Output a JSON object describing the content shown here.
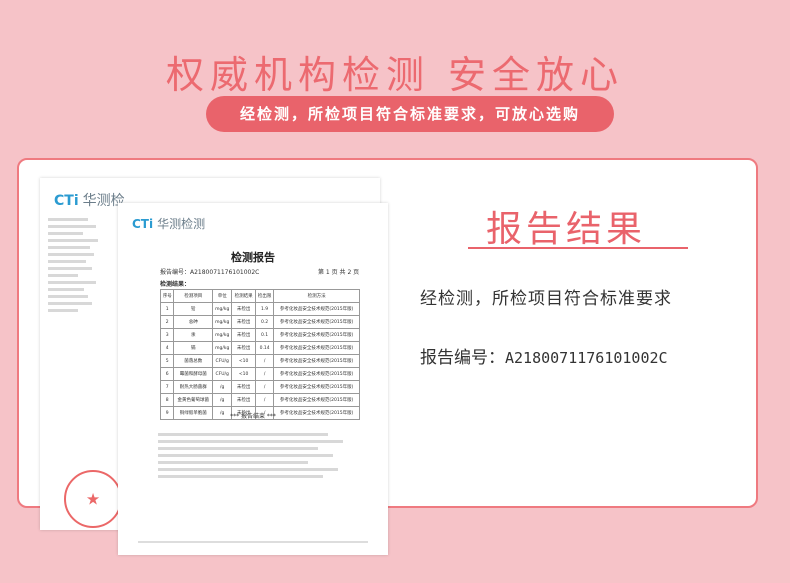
{
  "header": {
    "headline": "权威机构检测  安全放心",
    "subline": "经检测，所检项目符合标准要求，可放心选购"
  },
  "result": {
    "title": "报告结果",
    "description": "经检测，所检项目符合标准要求",
    "report_no_label": "报告编号：",
    "report_no_value": "A2180071176101002C"
  },
  "document": {
    "logo_mark": "CTi",
    "logo_text_back": "华测检",
    "logo_text_front": "华测检测",
    "title": "检测报告",
    "report_ref": "报告编号：A2180071176101002C",
    "page": "第 1 页 共 2 页",
    "section": "检测结果：",
    "end": "*** 报告结束 ***",
    "columns": [
      "序号",
      "检测项目",
      "单位",
      "检测结果",
      "检出限",
      "检测方法"
    ],
    "rows": [
      [
        "1",
        "铅",
        "mg/kg",
        "未检出",
        "1.9",
        "参考化妆品安全技术规范(2015年版)"
      ],
      [
        "2",
        "总砷",
        "mg/kg",
        "未检出",
        "0.2",
        "参考化妆品安全技术规范(2015年版)"
      ],
      [
        "3",
        "汞",
        "mg/kg",
        "未检出",
        "0.1",
        "参考化妆品安全技术规范(2015年版)"
      ],
      [
        "4",
        "镉",
        "mg/kg",
        "未检出",
        "0.14",
        "参考化妆品安全技术规范(2015年版)"
      ],
      [
        "5",
        "菌落总数",
        "CFU/g",
        "<10",
        "/",
        "参考化妆品安全技术规范(2015年版)"
      ],
      [
        "6",
        "霉菌和酵母菌",
        "CFU/g",
        "<10",
        "/",
        "参考化妆品安全技术规范(2015年版)"
      ],
      [
        "7",
        "耐热大肠菌群",
        "/g",
        "未检出",
        "/",
        "参考化妆品安全技术规范(2015年版)"
      ],
      [
        "8",
        "金黄色葡萄球菌",
        "/g",
        "未检出",
        "/",
        "参考化妆品安全技术规范(2015年版)"
      ],
      [
        "9",
        "铜绿假单胞菌",
        "/g",
        "未检出",
        "/",
        "参考化妆品安全技术规范(2015年版)"
      ]
    ]
  },
  "colors": {
    "accent": "#e9636b",
    "background": "#f6c3c8",
    "logo": "#2b9bd1",
    "stamp": "#e84e4e"
  }
}
